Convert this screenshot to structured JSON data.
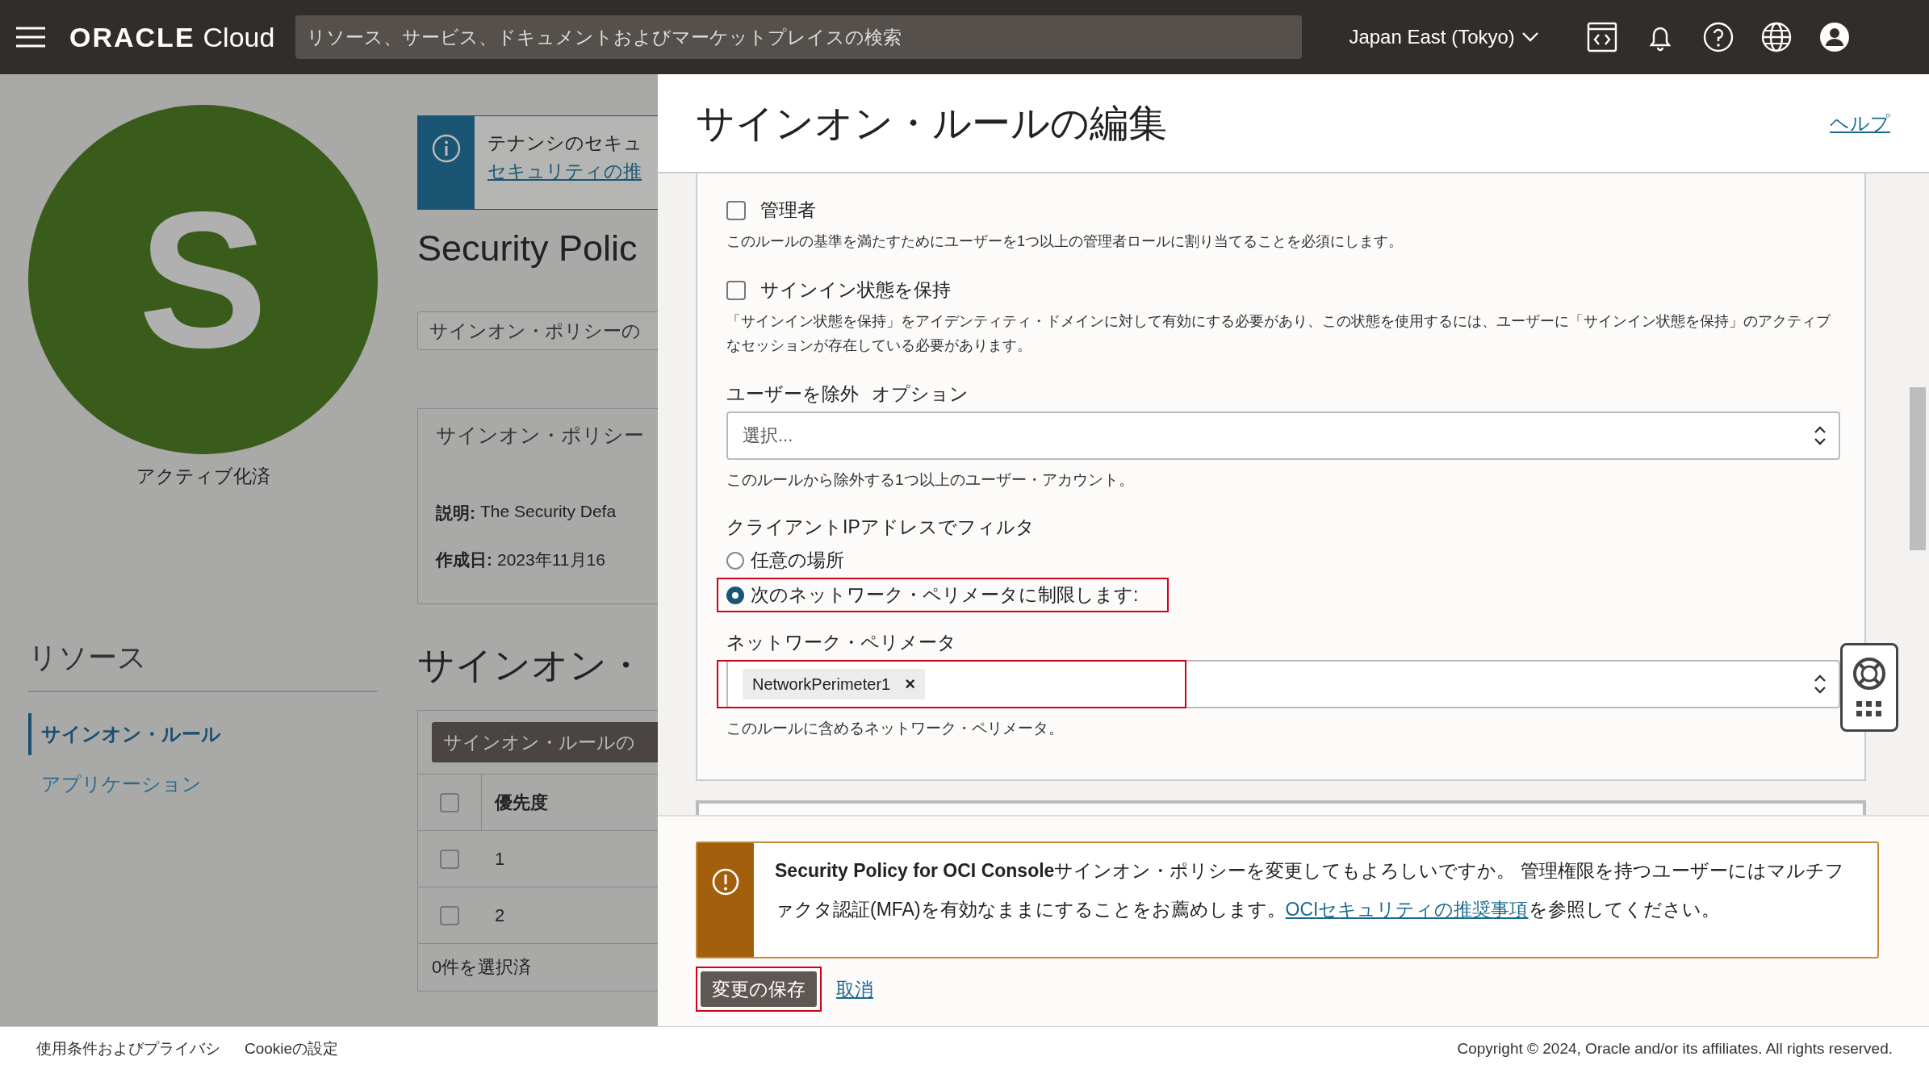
{
  "topbar": {
    "brand": "ORACLE",
    "product": "Cloud",
    "search": {
      "placeholder": "リソース、サービス、ドキュメントおよびマーケットプレイスの検索"
    },
    "region": "Japan East (Tokyo)"
  },
  "resource": {
    "initial": "S",
    "status": "アクティブ化済"
  },
  "resources_nav": {
    "title": "リソース",
    "items": [
      {
        "label": "サインオン・ルール",
        "selected": true
      },
      {
        "label": "アプリケーション",
        "selected": false
      }
    ]
  },
  "background_page": {
    "banner": {
      "text": "テナンシのセキュ",
      "link": "セキュリティの推"
    },
    "title": "Security Polic",
    "edit_button": "サインオン・ポリシーの",
    "info_card": {
      "title": "サインオン・ポリシー",
      "fields": [
        {
          "label": "説明:",
          "value": "The Security Defa"
        },
        {
          "label": "作成日:",
          "value": "2023年11月16"
        }
      ]
    },
    "section_title": "サインオン・",
    "add_button": "サインオン・ルールの",
    "table": {
      "select_all": {
        "checked": false
      },
      "columns": [
        "優先度"
      ],
      "rows": [
        {
          "cells": [
            "1"
          ],
          "selected": false
        },
        {
          "cells": [
            "2"
          ],
          "selected": false
        }
      ],
      "selection_count": "0件を選択済"
    }
  },
  "panel": {
    "title": "サインオン・ルールの編集",
    "help": "ヘルプ",
    "checkboxes": [
      {
        "label": "管理者",
        "description": "このルールの基準を満たすためにユーザーを1つ以上の管理者ロールに割り当てることを必須にします。",
        "checked": false
      },
      {
        "label": "サインイン状態を保持",
        "description": "「サインイン状態を保持」をアイデンティティ・ドメインに対して有効にする必要があり、この状態を使用するには、ユーザーに「サインイン状態を保持」のアクティブなセッションが存在している必要があります。",
        "checked": false
      }
    ],
    "exclude_users": {
      "label": "ユーザーを除外",
      "optional": "オプション",
      "placeholder": "選択...",
      "help": "このルールから除外する1つ以上のユーザー・アカウント。"
    },
    "ip_filter": {
      "label": "クライアントIPアドレスでフィルタ",
      "options": [
        {
          "label": "任意の場所",
          "selected": false,
          "highlighted": false
        },
        {
          "label": "次のネットワーク・ペリメータに制限します:",
          "selected": true,
          "highlighted": true
        }
      ]
    },
    "network_perimeter": {
      "label": "ネットワーク・ペリメータ",
      "tags": [
        {
          "label": "NetworkPerimeter1",
          "remove": "×"
        }
      ],
      "help": "このルールに含めるネットワーク・ペリメータ。",
      "highlighted": true
    },
    "warning": {
      "text": "**Security Policy for OCI Console**サインオン・ポリシーを変更してもよろしいですか。 管理権限を持つユーザーにはマルチファクタ認証(MFA)を有効なままにすることをお薦めします。",
      "link": "OCIセキュリティの推奨事項",
      "after": "を参照してください。"
    },
    "buttons": [
      {
        "label": "変更の保存",
        "kind": "primary",
        "highlighted": true
      },
      {
        "label": "取消",
        "kind": "link",
        "highlighted": false
      }
    ]
  },
  "footer": {
    "links": [
      "使用条件およびプライバシ",
      "Cookieの設定"
    ],
    "copyright": "Copyright © 2024, Oracle and/or its affiliates. All rights reserved."
  }
}
